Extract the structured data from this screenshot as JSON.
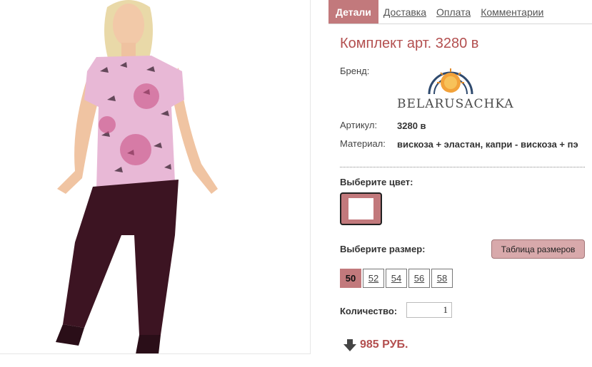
{
  "tabs": [
    {
      "label": "Детали"
    },
    {
      "label": "Доставка"
    },
    {
      "label": "Оплата"
    },
    {
      "label": "Комментарии"
    }
  ],
  "product": {
    "title": "Комплект арт. 3280 в",
    "brand_label": "Бренд:",
    "brand_name": "BELARUSACHKA",
    "article_label": "Артикул:",
    "article_value": "3280 в",
    "material_label": "Материал:",
    "material_value": "вискоза + эластан, капри - вискоза + пэ"
  },
  "color_section": {
    "label": "Выберите цвет:"
  },
  "size_section": {
    "label": "Выберите размер:",
    "table_button": "Таблица размеров",
    "sizes": [
      "50",
      "52",
      "54",
      "56",
      "58"
    ],
    "selected": "50"
  },
  "quantity": {
    "label": "Количество:",
    "value": "1"
  },
  "price": {
    "text": "985 РУБ."
  },
  "colors": {
    "accent": "#c2797c",
    "title": "#b34f4f"
  },
  "icons": {
    "price": "arrow-down-icon",
    "brand": "sun-logo-icon"
  }
}
